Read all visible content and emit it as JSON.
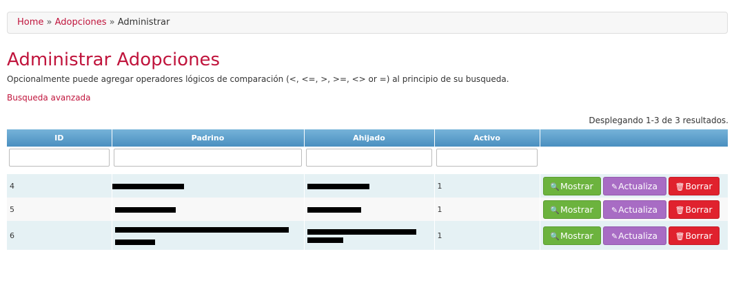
{
  "breadcrumb": {
    "home": "Home",
    "sep1": "»",
    "section": "Adopciones",
    "sep2": "»",
    "current": "Administrar"
  },
  "page": {
    "title": "Administrar Adopciones",
    "hint": "Opcionalmente puede agregar operadores lógicos de comparación (<, <=, >, >=, <> or =) al principio de su busqueda.",
    "advanced_link": "Busqueda avanzada",
    "summary": "Desplegando 1-3 de 3 resultados."
  },
  "grid": {
    "headers": {
      "id": "ID",
      "padrino": "Padrino",
      "ahijado": "Ahijado",
      "activo": "Activo"
    },
    "rows": [
      {
        "id": "4",
        "activo": "1"
      },
      {
        "id": "5",
        "activo": "1"
      },
      {
        "id": "6",
        "activo": "1"
      }
    ],
    "buttons": {
      "show": "Mostrar",
      "update": "Actualiza",
      "delete": "Borrar"
    },
    "icons": {
      "show": "zoom-in-icon",
      "update": "edit-icon",
      "delete": "trash-icon"
    }
  },
  "colors": {
    "accent": "#c0143c",
    "header": "#4a8fc0",
    "show": "#6cb33e",
    "update": "#a86cc4",
    "delete": "#e0222e"
  }
}
